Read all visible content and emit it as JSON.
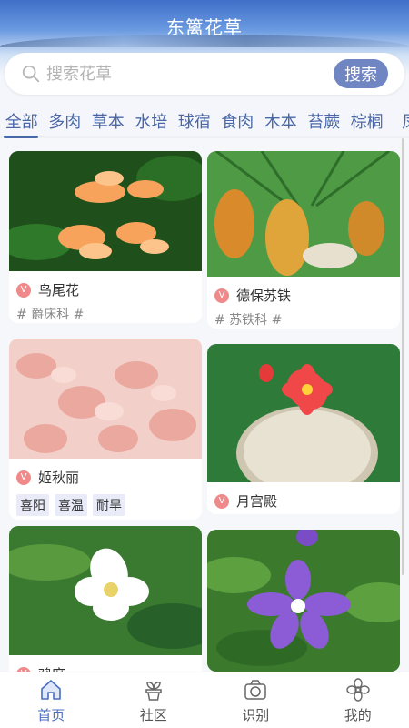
{
  "app": {
    "title": "东篱花草"
  },
  "search": {
    "placeholder": "搜索花草",
    "value": "",
    "button_label": "搜索"
  },
  "tabs": [
    {
      "label": "全部",
      "active": true
    },
    {
      "label": "多肉"
    },
    {
      "label": "草本"
    },
    {
      "label": "水培"
    },
    {
      "label": "球宿"
    },
    {
      "label": "食肉"
    },
    {
      "label": "木本"
    },
    {
      "label": "苔蕨"
    },
    {
      "label": "棕榈"
    },
    {
      "label": "凤"
    }
  ],
  "plants": [
    {
      "name": "鸟尾花",
      "family": "# 爵床科 #",
      "badge": "V",
      "image": "orange-flower",
      "colors": [
        "#1f5a1a",
        "#f7a35c"
      ]
    },
    {
      "name": "德保苏铁",
      "family": "# 苏铁科 #",
      "badge": "V",
      "image": "cycad-cones",
      "colors": [
        "#3d8a3a",
        "#d9a03a"
      ]
    },
    {
      "name": "姬秋丽",
      "tags": [
        "喜阳",
        "喜温",
        "耐旱"
      ],
      "badge": "V",
      "image": "pink-succulent",
      "colors": [
        "#f5c9c2",
        "#e9a79d"
      ]
    },
    {
      "name": "月宫殿",
      "badge": "V",
      "image": "cactus-red-flower",
      "colors": [
        "#2f7d3a",
        "#f04848"
      ]
    },
    {
      "name": "鸡麻",
      "badge": "V",
      "image": "white-flower",
      "colors": [
        "#2f6d2a",
        "#ffffff"
      ]
    },
    {
      "name": "",
      "badge": "",
      "image": "purple-flower",
      "colors": [
        "#3b7a2c",
        "#8b5cd6"
      ]
    }
  ],
  "nav": [
    {
      "label": "首页",
      "icon": "home-icon",
      "active": true
    },
    {
      "label": "社区",
      "icon": "plant-pot-icon"
    },
    {
      "label": "识别",
      "icon": "camera-icon"
    },
    {
      "label": "我的",
      "icon": "flower-icon"
    }
  ],
  "colors": {
    "accent": "#4a68a8",
    "button": "#6f86c2",
    "badge": "#f08a8a",
    "tag_bg": "#e9ecf8"
  }
}
